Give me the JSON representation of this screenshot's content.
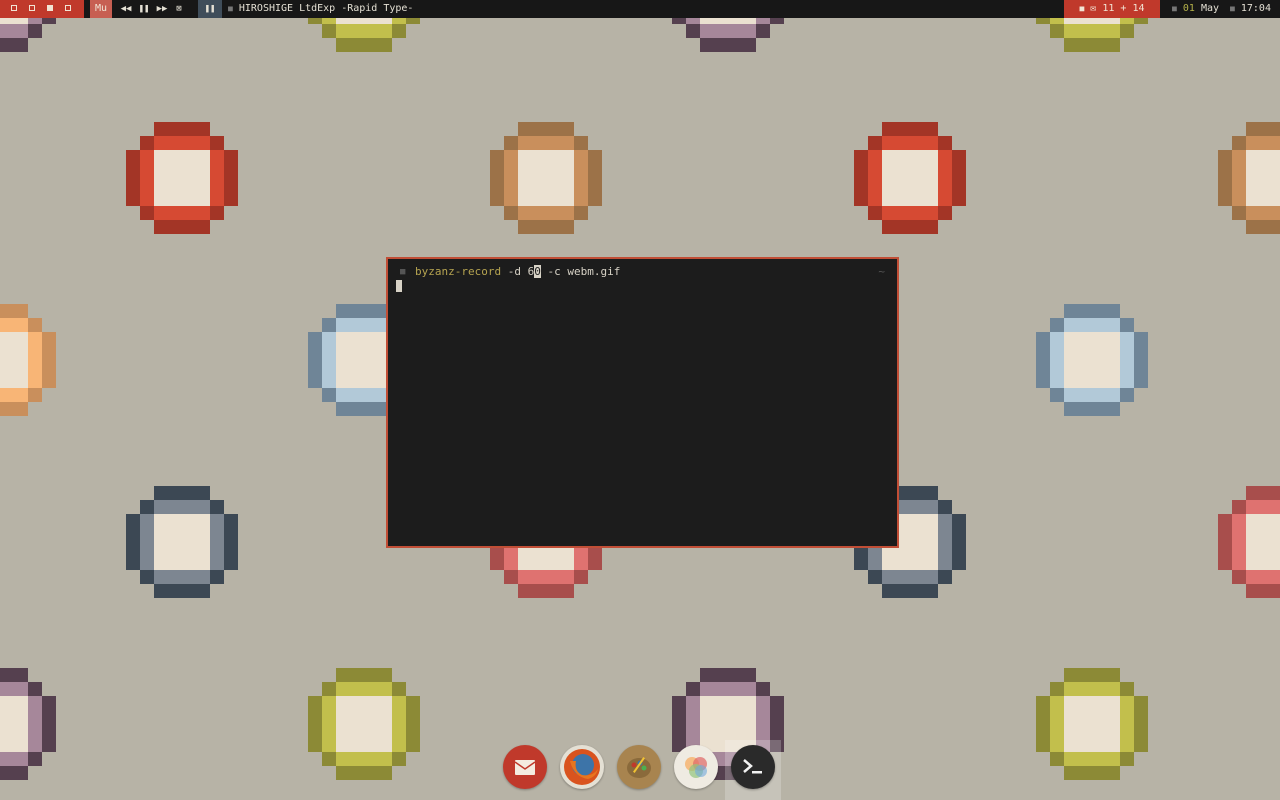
{
  "topbar": {
    "workspaces": [
      "ws1",
      "ws2",
      "ws3",
      "ws4"
    ],
    "player_label": "Mu",
    "media_buttons": [
      {
        "name": "rewind-icon",
        "glyph": "◀◀"
      },
      {
        "name": "pause-icon",
        "glyph": "❚❚"
      },
      {
        "name": "fast-forward-icon",
        "glyph": "▶▶"
      },
      {
        "name": "stop-icon",
        "glyph": "⊠"
      }
    ],
    "pause_glyph": "❚❚",
    "window_title": "HIROSHIGE LtdExp -Rapid Type-",
    "mail": {
      "icon": "mail-icon",
      "count": "11 + 14"
    },
    "date": {
      "day": "01",
      "month": "May"
    },
    "time": "17:04"
  },
  "colors": {
    "background": "#b7b3a6",
    "accent": "#c0392b",
    "terminal_bg": "#1c1c1c",
    "terminal_border": "#c14e36"
  },
  "terminal": {
    "command": "byzanz-record",
    "args_before_cursor": " -d 6",
    "cursor_char": "0",
    "args_after_cursor": " -c webm.gif",
    "tilde": "~"
  },
  "dock": [
    {
      "name": "mail-app-icon"
    },
    {
      "name": "firefox-icon"
    },
    {
      "name": "paint-app-icon"
    },
    {
      "name": "color-picker-icon"
    },
    {
      "name": "terminal-app-icon"
    }
  ]
}
